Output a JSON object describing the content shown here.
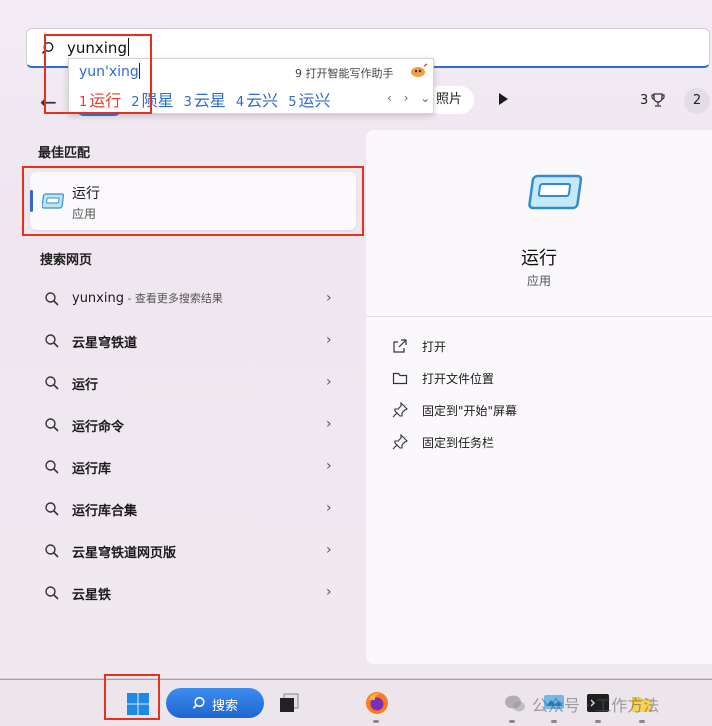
{
  "search": {
    "query": "yunxing"
  },
  "top_bar": {
    "photos_chip": "照片",
    "reward_count": "3",
    "avatar_initial": "2"
  },
  "ime": {
    "pinyin": "yun'xing",
    "assist_number": "9",
    "assist_label": "打开智能写作助手",
    "candidates": [
      {
        "num": "1",
        "text": "运行"
      },
      {
        "num": "2",
        "text": "陨星"
      },
      {
        "num": "3",
        "text": "云星"
      },
      {
        "num": "4",
        "text": "云兴"
      },
      {
        "num": "5",
        "text": "运兴"
      }
    ],
    "nav": "‹ › ⌄"
  },
  "best_match": {
    "heading": "最佳匹配",
    "name": "运行",
    "type": "应用"
  },
  "web": {
    "heading": "搜索网页",
    "items": [
      {
        "text": "yunxing",
        "sub": " - 查看更多搜索结果"
      },
      {
        "text": "云星穹铁道",
        "sub": ""
      },
      {
        "text": "运行",
        "sub": ""
      },
      {
        "text": "运行命令",
        "sub": ""
      },
      {
        "text": "运行库",
        "sub": ""
      },
      {
        "text": "运行库合集",
        "sub": ""
      },
      {
        "text": "云星穹铁道网页版",
        "sub": ""
      },
      {
        "text": "云星铁",
        "sub": ""
      }
    ]
  },
  "detail": {
    "name": "运行",
    "type": "应用",
    "actions": [
      {
        "icon": "open-external-icon",
        "label": "打开"
      },
      {
        "icon": "folder-icon",
        "label": "打开文件位置"
      },
      {
        "icon": "pin-icon",
        "label": "固定到\"开始\"屏幕"
      },
      {
        "icon": "pin-icon",
        "label": "固定到任务栏"
      }
    ]
  },
  "taskbar": {
    "search_label": "搜索",
    "watermark": "公众号 · 工作方法"
  },
  "colors": {
    "accent": "#2f6cc9",
    "highlight": "#e5321f",
    "ime_first": "#e23c2c"
  }
}
